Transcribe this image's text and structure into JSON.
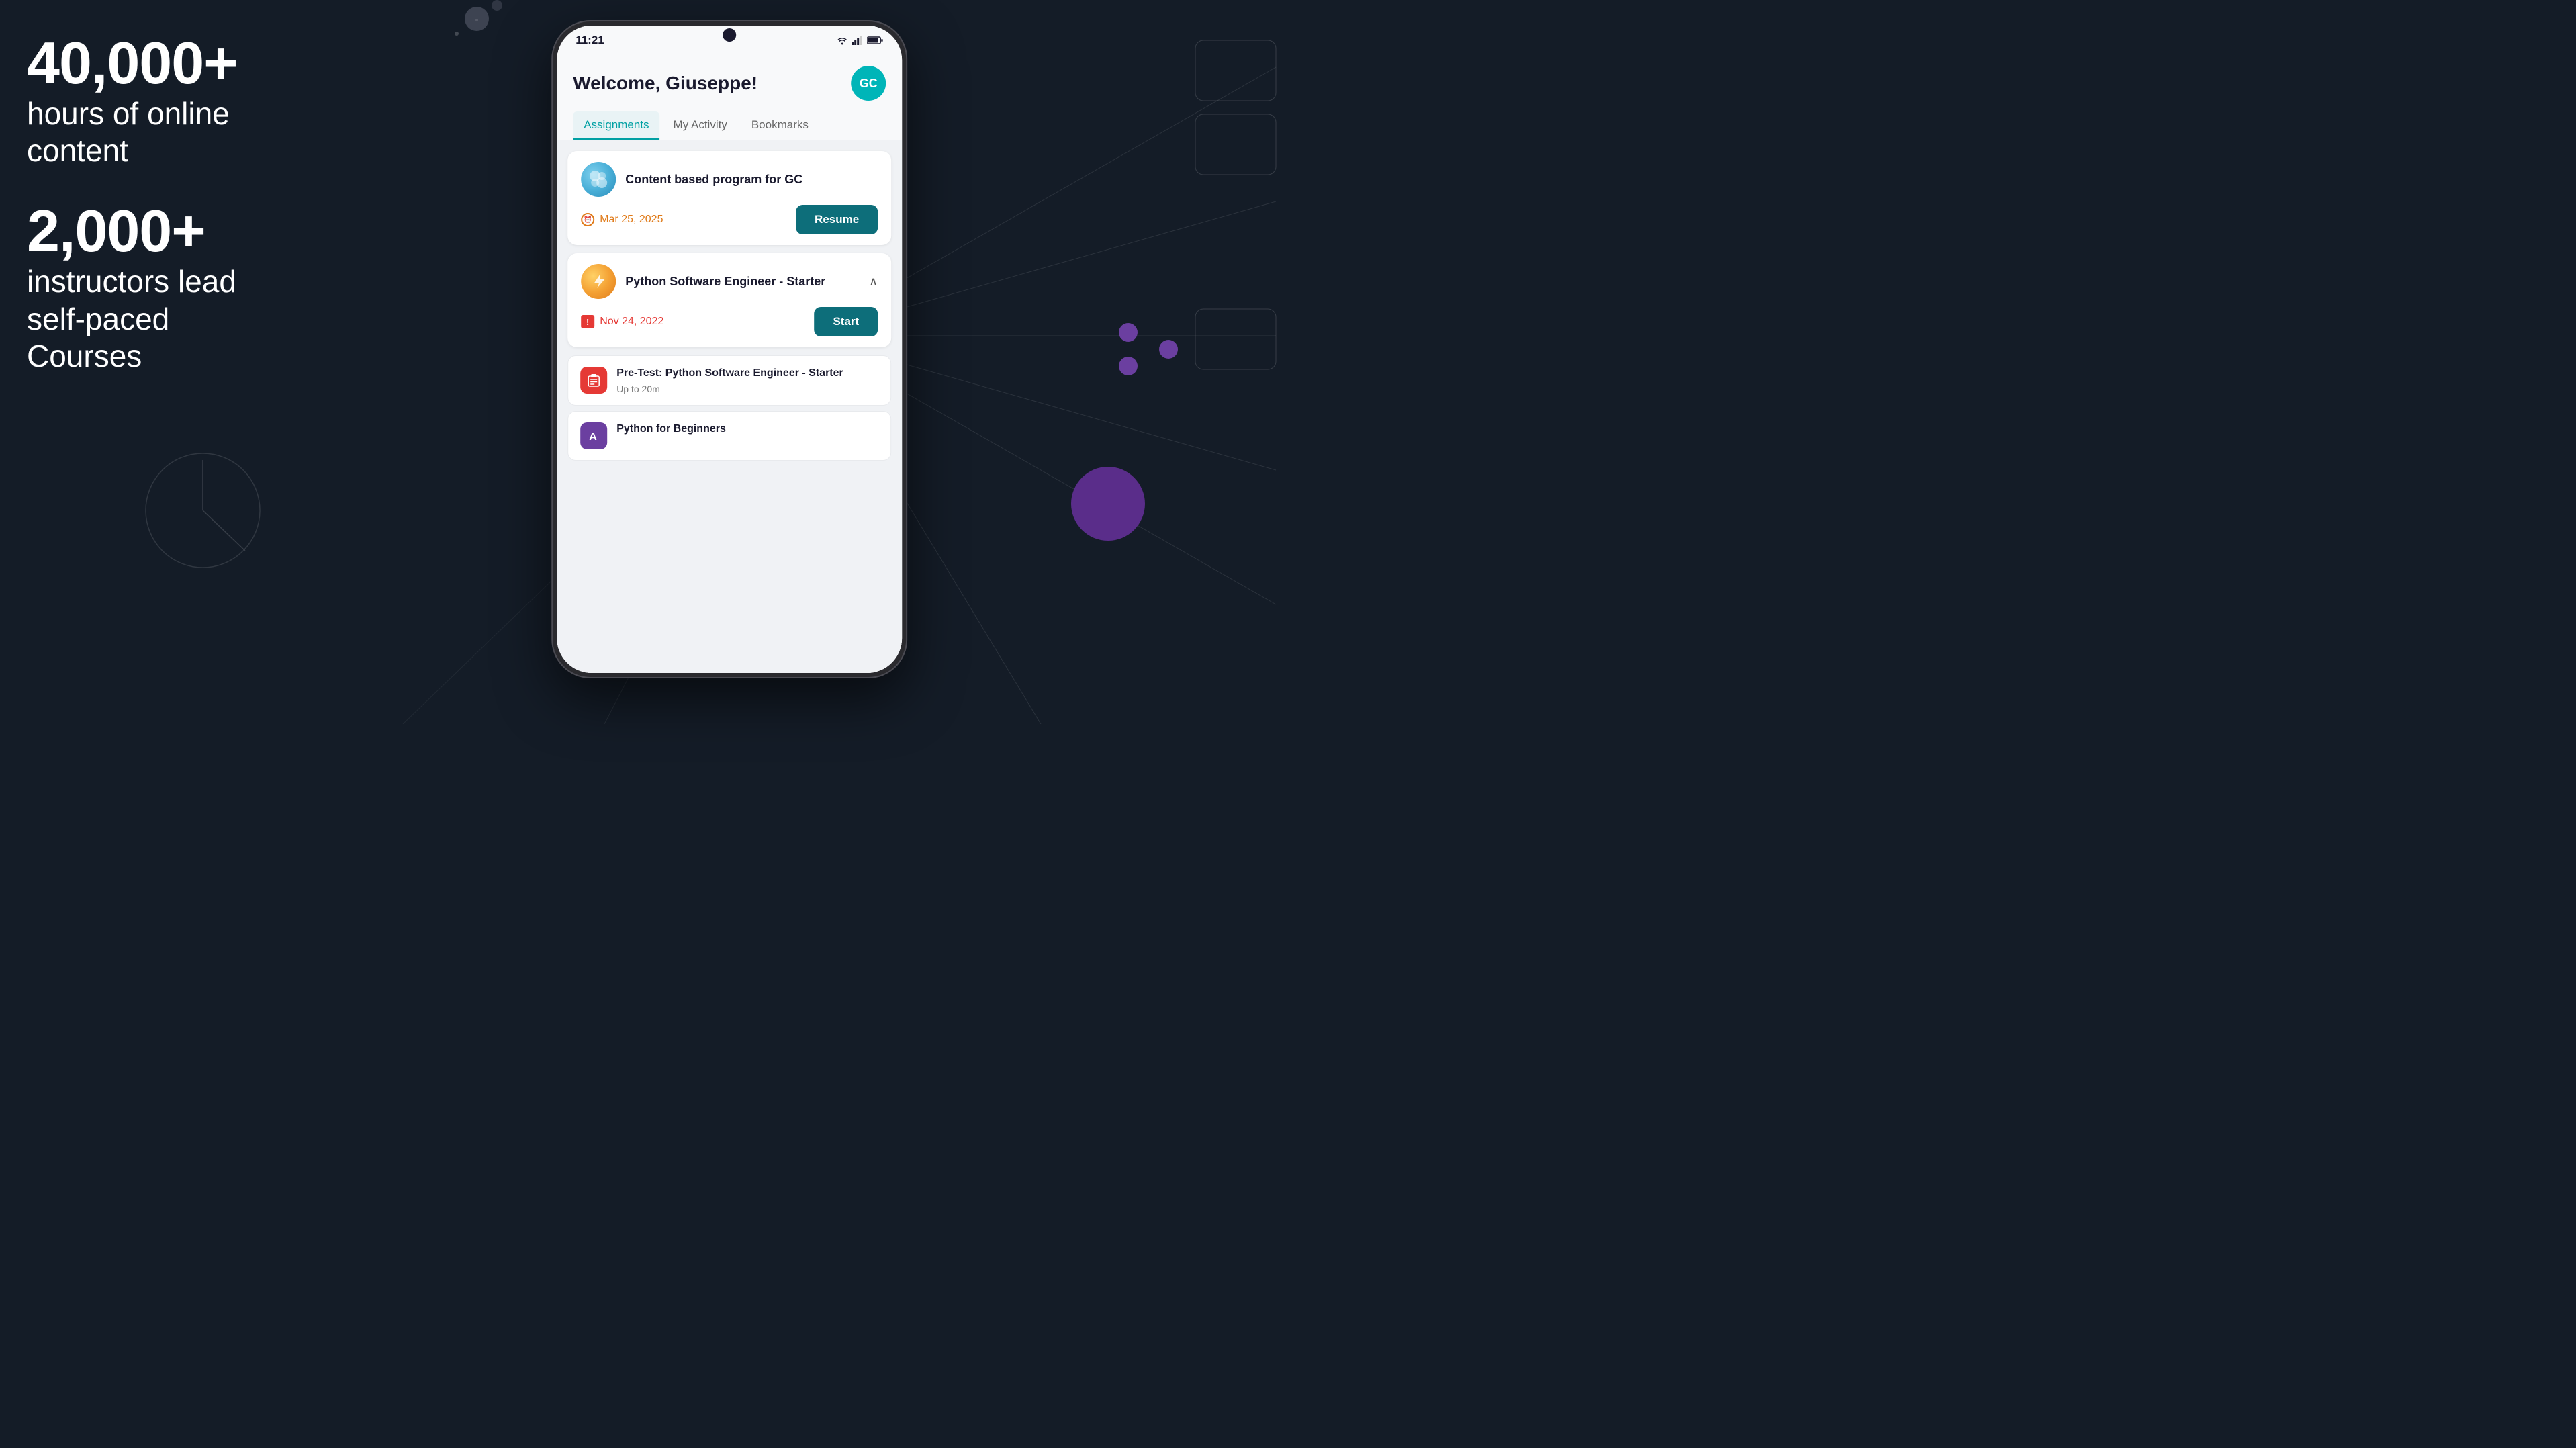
{
  "background": {
    "color": "#141c27"
  },
  "left": {
    "stat1_number": "40,000+",
    "stat1_desc": "hours of online\ncontent",
    "stat2_number": "2,000+",
    "stat2_desc": "instructors lead\nself-paced\nCourses"
  },
  "phone": {
    "status_bar": {
      "time": "11:21",
      "icons": "wifi signal battery"
    },
    "header": {
      "welcome": "Welcome, Giuseppe!",
      "avatar_initials": "GC",
      "avatar_color": "#00b5b8"
    },
    "tabs": [
      {
        "label": "Assignments",
        "active": true
      },
      {
        "label": "My Activity",
        "active": false
      },
      {
        "label": "Bookmarks",
        "active": false
      }
    ],
    "assignments": [
      {
        "id": "card1",
        "icon_type": "blue",
        "title": "Content based program for GC",
        "date": "Mar 25, 2025",
        "date_type": "warning",
        "action": "Resume",
        "expanded": false
      },
      {
        "id": "card2",
        "icon_type": "orange",
        "title": "Python Software Engineer - Starter",
        "date": "Nov 24, 2022",
        "date_type": "error",
        "action": "Start",
        "expanded": true,
        "sub_items": [
          {
            "icon_type": "red",
            "title": "Pre-Test: Python Software Engineer - Starter",
            "duration": "Up to 20m"
          },
          {
            "icon_type": "purple",
            "title": "Python for Beginners",
            "duration": ""
          }
        ]
      }
    ]
  }
}
